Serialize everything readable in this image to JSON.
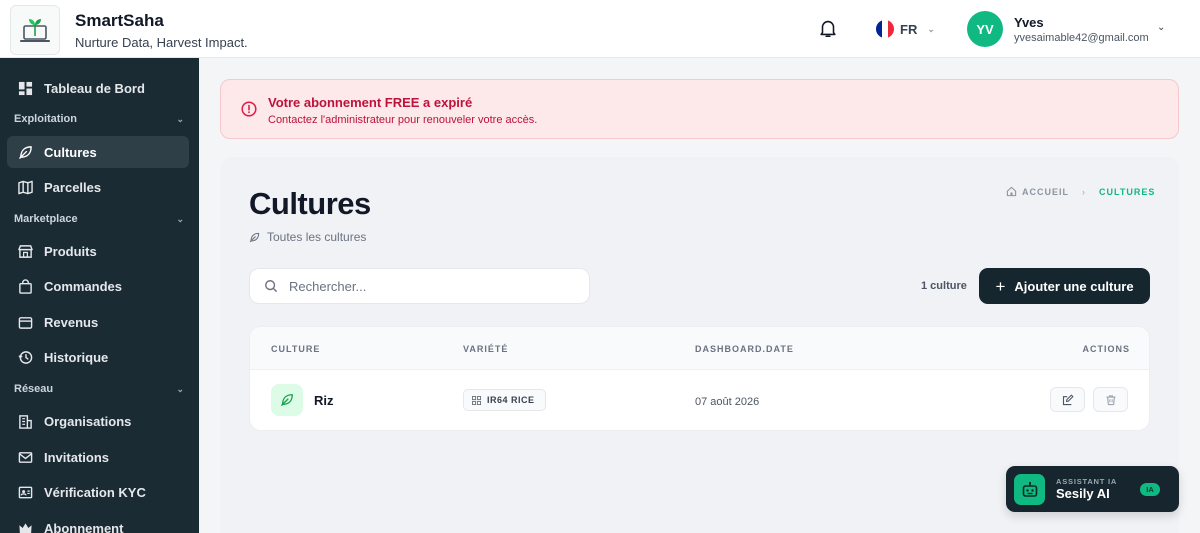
{
  "header": {
    "brand_name": "SmartSaha",
    "tagline": "Nurture Data, Harvest Impact.",
    "language": "FR",
    "user": {
      "initials": "YV",
      "name": "Yves",
      "email": "yvesaimable42@gmail.com"
    },
    "colors": {
      "avatar": "#10b981",
      "flag": [
        "#002395",
        "#ffffff",
        "#ed2939"
      ]
    }
  },
  "sidebar": {
    "dashboard": {
      "label": "Tableau de Bord",
      "icon": "dashboard-icon"
    },
    "sections": {
      "exploitation": "Exploitation",
      "marketplace": "Marketplace",
      "reseau": "Réseau"
    },
    "items": {
      "cultures": {
        "label": "Cultures",
        "icon": "leaf-icon",
        "active": true
      },
      "parcelles": {
        "label": "Parcelles",
        "icon": "map-icon"
      },
      "produits": {
        "label": "Produits",
        "icon": "store-icon"
      },
      "commandes": {
        "label": "Commandes",
        "icon": "bag-icon"
      },
      "revenus": {
        "label": "Revenus",
        "icon": "wallet-icon"
      },
      "historique": {
        "label": "Historique",
        "icon": "history-icon"
      },
      "organisations": {
        "label": "Organisations",
        "icon": "building-icon"
      },
      "invitations": {
        "label": "Invitations",
        "icon": "mail-icon"
      },
      "kyc": {
        "label": "Vérification KYC",
        "icon": "id-card-icon"
      },
      "abonnement": {
        "label": "Abonnement",
        "icon": "crown-icon"
      }
    }
  },
  "alert": {
    "title": "Votre abonnement FREE a expiré",
    "message": "Contactez l'administrateur pour renouveler votre accès."
  },
  "page": {
    "title": "Cultures",
    "subtitle": "Toutes les cultures",
    "breadcrumb": {
      "home": "ACCUEIL",
      "current": "CULTURES"
    },
    "search_placeholder": "Rechercher...",
    "count": "1 culture",
    "add_label": "Ajouter une culture"
  },
  "table": {
    "headers": {
      "culture": "CULTURE",
      "variety": "VARIÉTÉ",
      "date": "DASHBOARD.DATE",
      "actions": "ACTIONS"
    },
    "rows": [
      {
        "name": "Riz",
        "variety": "IR64 RICE",
        "date": "07 août 2026"
      }
    ]
  },
  "assistant": {
    "label": "ASSISTANT IA",
    "name": "Sesily AI",
    "badge": "IA"
  }
}
